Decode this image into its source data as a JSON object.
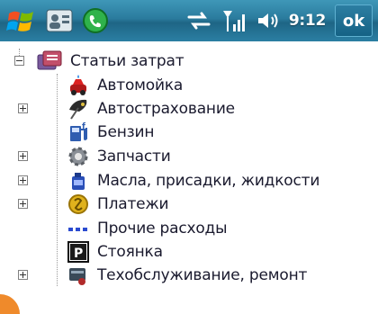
{
  "status": {
    "time": "9:12",
    "ok_label": "ok"
  },
  "tree": {
    "root": {
      "label": "Статьи затрат"
    },
    "items": [
      {
        "label": "Автомойка",
        "icon": "car-wash-icon",
        "expandable": false
      },
      {
        "label": "Автострахование",
        "icon": "umbrella-icon",
        "expandable": true
      },
      {
        "label": "Бензин",
        "icon": "fuel-pump-icon",
        "expandable": false
      },
      {
        "label": "Запчасти",
        "icon": "gear-icon",
        "expandable": true
      },
      {
        "label": "Масла, присадки, жидкости",
        "icon": "oil-can-icon",
        "expandable": true
      },
      {
        "label": "Платежи",
        "icon": "coin-icon",
        "expandable": true
      },
      {
        "label": "Прочие расходы",
        "icon": "dots-icon",
        "expandable": false
      },
      {
        "label": "Стоянка",
        "icon": "parking-icon",
        "expandable": false
      },
      {
        "label": "Техобслуживание, ремонт",
        "icon": "tools-icon",
        "expandable": true
      }
    ]
  }
}
